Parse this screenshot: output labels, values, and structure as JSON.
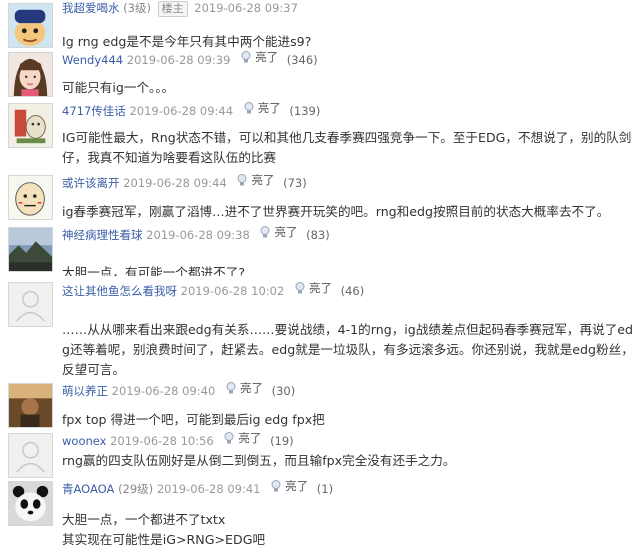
{
  "like_label": "亮了",
  "owner_badge": "楼主",
  "colors": {
    "username": "#3b5ea8",
    "timestamp": "#999999",
    "text": "#333333"
  },
  "posts": [
    {
      "username": "我超爱喝水",
      "level": "(3级)",
      "owner": true,
      "time": "2019-06-28 09:37",
      "content": "Ig rng edg是不是今年只有其中两个能进s9?"
    },
    {
      "username": "Wendy444",
      "time": "2019-06-28 09:39",
      "likes": "(346)",
      "content": "可能只有ig一个。。。"
    },
    {
      "username": "4717传佳话",
      "time": "2019-06-28 09:44",
      "likes": "(139)",
      "content": "IG可能性最大，Rng状态不错，可以和其他几支春季赛四强竞争一下。至于EDG，不想说了，别的队剑仔，我真不知道为啥要看这队伍的比赛"
    },
    {
      "username": "或许该离开",
      "time": "2019-06-28 09:44",
      "likes": "(73)",
      "content": "ig春季赛冠军，刚赢了滔博…进不了世界赛开玩笑的吧。rng和edg按照目前的状态大概率去不了。"
    },
    {
      "username": "神经病理性看球",
      "time": "2019-06-28 09:38",
      "likes": "(83)",
      "content": "大胆一点，有可能一个都进不了?"
    },
    {
      "username": "这让其他鱼怎么看我呀",
      "time": "2019-06-28 10:02",
      "likes": "(46)",
      "content": "……从从哪来看出来跟edg有关系……要说战绩，4-1的rng，ig战绩差点但起码春季赛冠军，再说了edg还等着呢，别浪费时间了，赶紧去。edg就是一垃圾队，有多远滚多远。你还别说，我就是edg粉丝，反望可言。"
    },
    {
      "username": "萌以养正",
      "time": "2019-06-28 09:40",
      "likes": "(30)",
      "content": "fpx top 得进一个吧，可能到最后ig edg fpx把"
    },
    {
      "username": "woonex",
      "time": "2019-06-28 10:56",
      "likes": "(19)",
      "content": "rng赢的四支队伍刚好是从倒二到倒五，而且输fpx完全没有还手之力。"
    },
    {
      "username": "青AOAOA",
      "level": "(29级)",
      "time": "2019-06-28 09:41",
      "likes": "(1)",
      "content": "大胆一点，一个都进不了txtx\n其实现在可能性是iG>RNG>EDG吧"
    }
  ]
}
